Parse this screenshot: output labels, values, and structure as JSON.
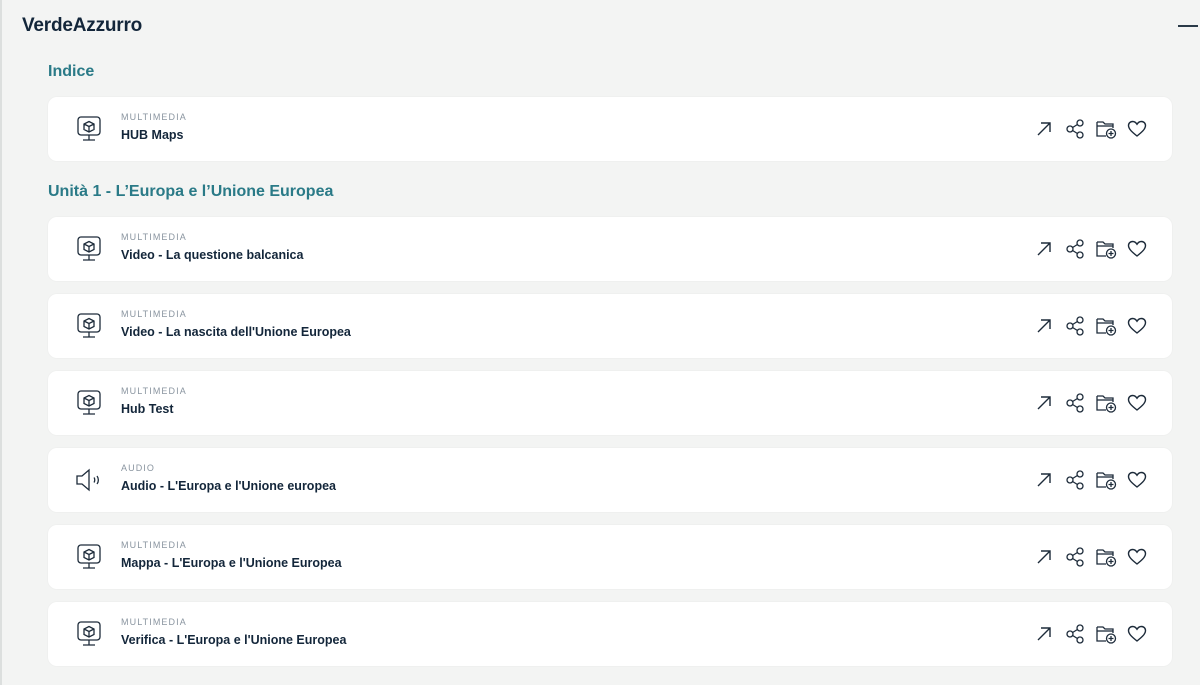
{
  "app": {
    "title": "VerdeAzzurro"
  },
  "icons": {
    "collapse": "minus-icon",
    "multimedia": "monitor-cube-icon",
    "audio": "speaker-icon",
    "open": "arrow-up-right-icon",
    "share": "share-icon",
    "add_folder": "folder-add-icon",
    "favorite": "heart-icon"
  },
  "sections": [
    {
      "title": "Indice",
      "items": [
        {
          "kind": "MULTIMEDIA",
          "name": "HUB Maps"
        }
      ]
    },
    {
      "title": "Unità 1 - L’Europa e l’Unione Europea",
      "items": [
        {
          "kind": "MULTIMEDIA",
          "name": "Video - La questione balcanica"
        },
        {
          "kind": "MULTIMEDIA",
          "name": "Video - La nascita dell'Unione Europea"
        },
        {
          "kind": "MULTIMEDIA",
          "name": "Hub Test"
        },
        {
          "kind": "AUDIO",
          "name": "Audio - L'Europa e l'Unione europea"
        },
        {
          "kind": "MULTIMEDIA",
          "name": "Mappa - L'Europa e l'Unione Europea"
        },
        {
          "kind": "MULTIMEDIA",
          "name": "Verifica - L'Europa e l'Unione Europea"
        }
      ]
    }
  ]
}
